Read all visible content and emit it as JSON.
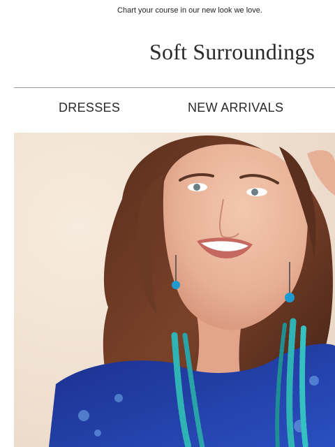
{
  "preheader": {
    "text": "Chart your course in our new look we love."
  },
  "brand": {
    "logo_text": "Soft Surroundings"
  },
  "nav": {
    "items": [
      {
        "label": "DRESSES"
      },
      {
        "label": "NEW ARRIVALS"
      }
    ]
  },
  "colors": {
    "background": "#ffffff",
    "divider": "#9a9a9a",
    "hero_backdrop": "#f3e4d6",
    "dress_blue": "#1f3fa6",
    "turquoise_beads": "#2fb3b4"
  }
}
